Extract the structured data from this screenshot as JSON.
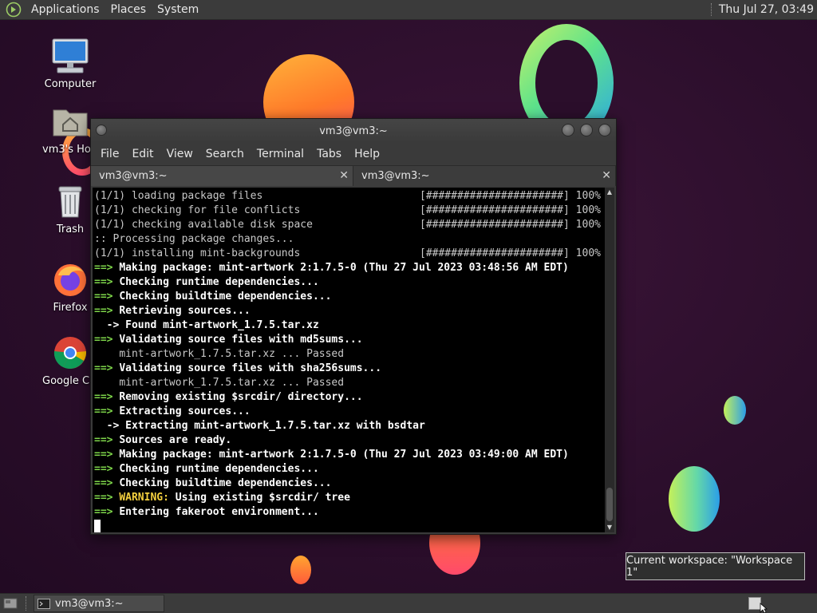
{
  "top_panel": {
    "menus": [
      "Applications",
      "Places",
      "System"
    ],
    "clock": "Thu Jul 27, 03:49"
  },
  "desktop": {
    "icons": [
      {
        "label": "Computer",
        "icon": "computer-icon"
      },
      {
        "label": "vm3's Home",
        "icon": "home-folder-icon"
      },
      {
        "label": "Trash",
        "icon": "trash-icon"
      },
      {
        "label": "Firefox",
        "icon": "firefox-icon"
      },
      {
        "label": "Google Chrome",
        "icon": "chrome-icon"
      }
    ]
  },
  "terminal": {
    "title": "vm3@vm3:~",
    "menu": [
      "File",
      "Edit",
      "View",
      "Search",
      "Terminal",
      "Tabs",
      "Help"
    ],
    "tabs": [
      {
        "label": "vm3@vm3:~",
        "active": true
      },
      {
        "label": "vm3@vm3:~",
        "active": false
      }
    ],
    "lines": [
      {
        "type": "progress",
        "text": "(1/1) loading package files",
        "bar": "[######################] 100%"
      },
      {
        "type": "progress",
        "text": "(1/1) checking for file conflicts",
        "bar": "[######################] 100%"
      },
      {
        "type": "progress",
        "text": "(1/1) checking available disk space",
        "bar": "[######################] 100%"
      },
      {
        "type": "plain",
        "text": ":: Processing package changes..."
      },
      {
        "type": "progress",
        "text": "(1/1) installing mint-backgrounds",
        "bar": "[######################] 100%"
      },
      {
        "type": "arrow",
        "text": "Making package: mint-artwork 2:1.7.5-0 (Thu 27 Jul 2023 03:48:56 AM EDT)"
      },
      {
        "type": "arrow",
        "text": "Checking runtime dependencies..."
      },
      {
        "type": "arrow",
        "text": "Checking buildtime dependencies..."
      },
      {
        "type": "arrow",
        "text": "Retrieving sources..."
      },
      {
        "type": "sub",
        "text": "Found mint-artwork_1.7.5.tar.xz"
      },
      {
        "type": "arrow",
        "text": "Validating source files with md5sums..."
      },
      {
        "type": "indent",
        "text": "mint-artwork_1.7.5.tar.xz ... Passed"
      },
      {
        "type": "arrow",
        "text": "Validating source files with sha256sums..."
      },
      {
        "type": "indent",
        "text": "mint-artwork_1.7.5.tar.xz ... Passed"
      },
      {
        "type": "arrow",
        "text": "Removing existing $srcdir/ directory..."
      },
      {
        "type": "arrow",
        "text": "Extracting sources..."
      },
      {
        "type": "sub",
        "text": "Extracting mint-artwork_1.7.5.tar.xz with bsdtar"
      },
      {
        "type": "arrow",
        "text": "Sources are ready."
      },
      {
        "type": "arrow",
        "text": "Making package: mint-artwork 2:1.7.5-0 (Thu 27 Jul 2023 03:49:00 AM EDT)"
      },
      {
        "type": "arrow",
        "text": "Checking runtime dependencies..."
      },
      {
        "type": "arrow",
        "text": "Checking buildtime dependencies..."
      },
      {
        "type": "warning",
        "label": "WARNING:",
        "text": " Using existing $srcdir/ tree"
      },
      {
        "type": "arrow",
        "text": "Entering fakeroot environment..."
      },
      {
        "type": "cursor",
        "text": ""
      }
    ],
    "arrow_prefix": "==> ",
    "sub_prefix": "  -> "
  },
  "tooltip": "Current workspace: \"Workspace 1\"",
  "bottom_panel": {
    "task": "vm3@vm3:~"
  },
  "colors": {
    "arrow": "#7ed64a",
    "warning": "#f4d03f",
    "terminal_bg": "#000000",
    "panel_bg": "#3b3b3b"
  }
}
